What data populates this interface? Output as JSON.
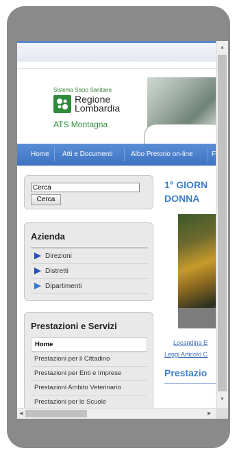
{
  "header": {
    "subtitle": "Sistema Socio Sanitario",
    "region": "Regione Lombardia",
    "agency": "ATS Montagna"
  },
  "nav": {
    "items": [
      "Home",
      "Atti e Documenti",
      "Albo Pretorio on-line",
      "F"
    ]
  },
  "search": {
    "input_value": "Cerca",
    "button_label": "Cerca"
  },
  "azienda": {
    "title": "Azienda",
    "items": [
      "Direzioni",
      "Distretti",
      "Dipartimenti"
    ]
  },
  "prestazioni": {
    "title": "Prestazioni e Servizi",
    "items": [
      "Home",
      "Prestazioni per il Cittadino",
      "Prestazioni per Enti e Imprese",
      "Prestazioni Ambito Veterinario",
      "Prestazioni per le Scuole"
    ]
  },
  "main": {
    "headline": "1° GIORN\nDONNA",
    "link_primary": "Locandina E",
    "link_secondary": "Leggi Articolo C",
    "section_title": "Prestazio"
  },
  "scrollbars": {
    "up_arrow": "▲",
    "down_arrow": "▼",
    "left_arrow": "◀",
    "right_arrow": "▶"
  }
}
